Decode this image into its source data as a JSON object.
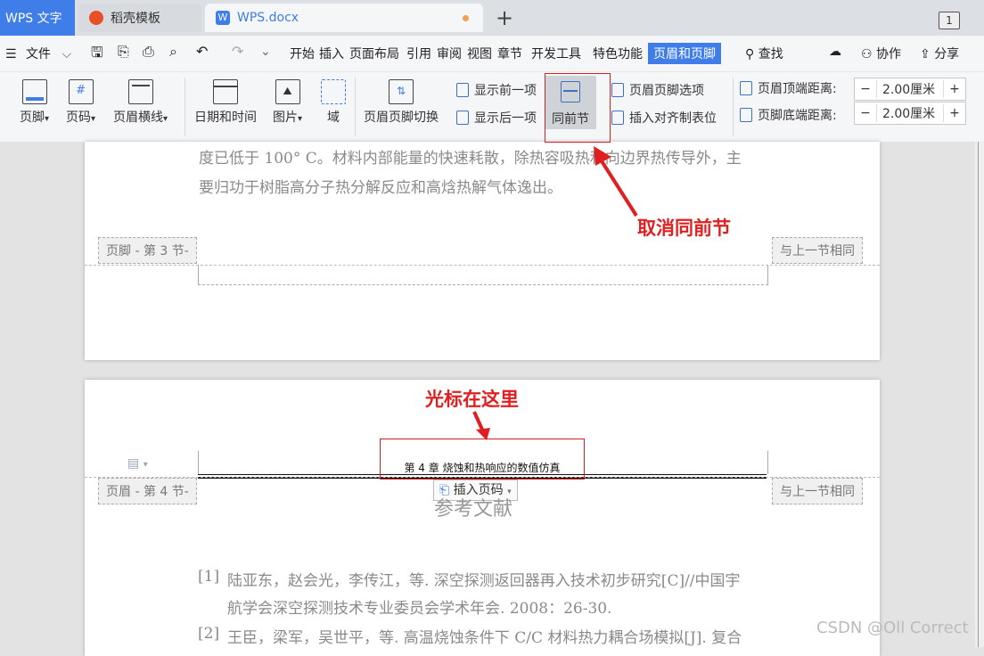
{
  "tabs": {
    "app": "WPS 文字",
    "template": "稻壳模板",
    "doc": "WPS.docx",
    "count": "1"
  },
  "menu": {
    "file": "文件",
    "items": [
      "开始",
      "插入",
      "页面布局",
      "引用",
      "审阅",
      "视图",
      "章节",
      "开发工具",
      "特色功能"
    ],
    "active": "页眉和页脚",
    "search": "查找",
    "collab": "协作",
    "share": "分享"
  },
  "ribbon": {
    "footer": "页脚",
    "page_num": "页码",
    "header_line": "页眉横线",
    "datetime": "日期和时间",
    "picture": "图片",
    "field": "域",
    "switch": "页眉页脚切换",
    "show_prev": "显示前一项",
    "show_next": "显示后一项",
    "same_prev": "同前节",
    "options": "页眉页脚选项",
    "align_tab": "插入对齐制表位",
    "header_top_label": "页眉顶端距离:",
    "header_top_value": "2.00厘米",
    "footer_bottom_label": "页脚底端距离:",
    "footer_bottom_value": "2.00厘米"
  },
  "page3": {
    "line1": "度已低于 100° C。材料内部能量的快速耗散，除热容吸热和向边界热传导外，主",
    "line2": "要归功于树脂高分子热分解反应和高焓热解气体逸出。",
    "footer_tag": "页脚 - 第 3 节-",
    "same_tag": "与上一节相同"
  },
  "page4": {
    "header_text": "第 4 章  烧蚀和热响应的数值仿真",
    "header_tag": "页眉 - 第 4 节-",
    "same_tag": "与上一节相同",
    "insert_page_num": "插入页码",
    "title": "参考文献",
    "ref1_num": "[1]",
    "ref1_line1": "陆亚东，赵会光，李传江，等. 深空探测返回器再入技术初步研究[C]//中国宇",
    "ref1_line2": "航学会深空探测技术专业委员会学术年会. 2008：26-30.",
    "ref2_num": "[2]",
    "ref2_line1": "王臣，梁军，吴世平，等. 高温烧蚀条件下 C/C 材料热力耦合场模拟[J]. 复合"
  },
  "annotations": {
    "cancel": "取消同前节",
    "cursor": "光标在这里"
  },
  "watermark": "CSDN @Oll Correct",
  "colors": {
    "accent": "#3f7de8",
    "annotation": "#e02020"
  }
}
